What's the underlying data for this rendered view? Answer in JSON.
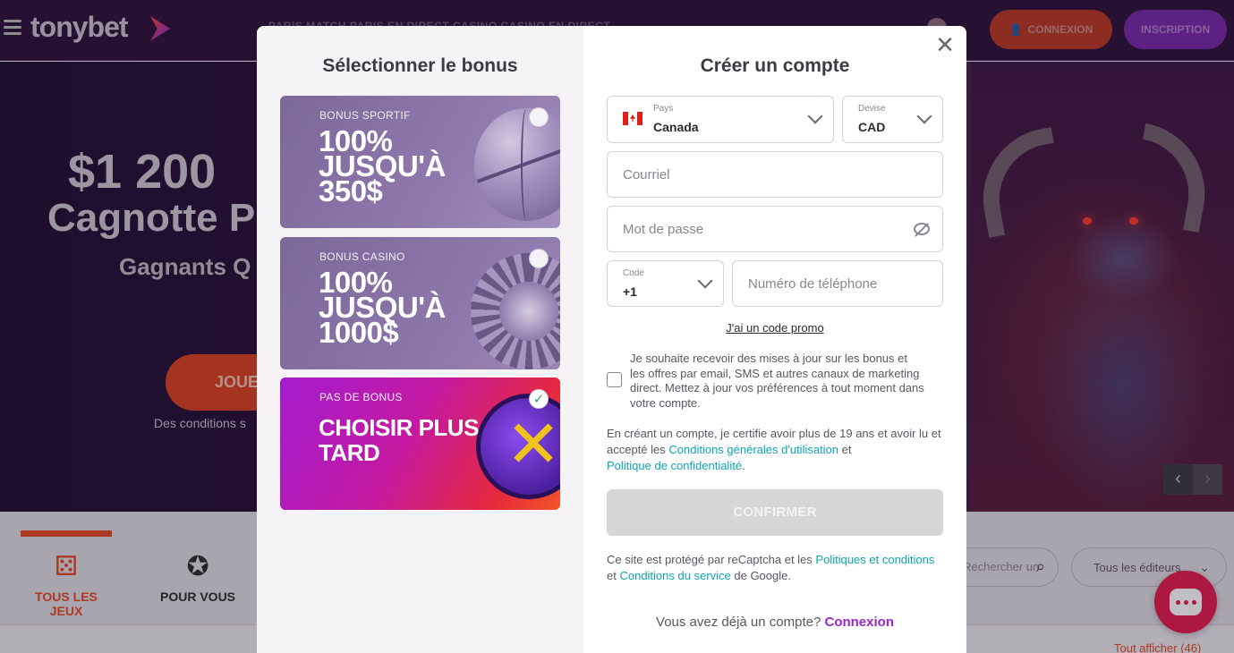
{
  "brand": {
    "name": "tonybet"
  },
  "header": {
    "nav_faded": "PARIS MATCH   PARIS EN DIRECT   CASINO   CASINO EN DIRECT",
    "connexion_label": "CONNEXION",
    "inscription_label": "INSCRIPTION"
  },
  "hero": {
    "amount": "$1 200",
    "line2": "Cagnotte P",
    "line3": "Gagnants Q",
    "play_label": "JOUE",
    "conditions": "Des conditions s"
  },
  "categories": {
    "tabs": [
      {
        "label": "TOUS LES JEUX",
        "icon": "dice-icon",
        "active": true
      },
      {
        "label": "POUR VOUS",
        "icon": "user-star-icon",
        "active": false
      }
    ],
    "search_placeholder": "Rechercher un",
    "editors_label": "Tous les éditeurs",
    "show_all": "Tout afficher  (46)"
  },
  "modal": {
    "left_title": "Sélectionner le bonus",
    "bonuses": [
      {
        "label": "BONUS SPORTIF",
        "headline": "100% JUSQU'À 350$",
        "selected": false,
        "art": "basketball-icon"
      },
      {
        "label": "BONUS CASINO",
        "headline": "100% JUSQU'À 1000$",
        "selected": false,
        "art": "roulette-icon"
      },
      {
        "label": "PAS DE BONUS",
        "headline": "CHOISIR PLUS TARD",
        "selected": true,
        "art": "x-coin-icon"
      }
    ],
    "right_title": "Créer un compte",
    "country": {
      "label": "Pays",
      "value": "Canada"
    },
    "currency": {
      "label": "Devise",
      "value": "CAD"
    },
    "email_placeholder": "Courriel",
    "password_placeholder": "Mot de passe",
    "phone_code": {
      "label": "Code",
      "value": "+1"
    },
    "phone_placeholder": "Numéro de téléphone",
    "promo_link": "J'ai un code promo",
    "consent_text": "Je souhaite recevoir des mises à jour sur les bonus et les offres par email, SMS et autres canaux de marketing direct. Mettez à jour vos préférences à tout moment dans votre compte.",
    "certify_prefix": "En créant un compte, je certifie avoir plus de 19 ans et avoir lu et accepté les ",
    "terms_link": "Conditions générales d'utilisation",
    "certify_and": " et ",
    "privacy_link": "Politique de confidentialité",
    "certify_end": ".",
    "confirm_label": "CONFIRMER",
    "recaptcha_prefix": "Ce site est protégé par reCaptcha et les ",
    "recaptcha_policies": "Politiques et conditions",
    "recaptcha_and": " et ",
    "recaptcha_terms": "Conditions du service",
    "recaptcha_suffix": " de Google.",
    "have_account": "Vous avez déjà un compte?",
    "login_link": "Connexion"
  },
  "colors": {
    "accent_orange": "#e34822",
    "accent_purple": "#9a24c9",
    "link_teal": "#0fa4b5"
  }
}
